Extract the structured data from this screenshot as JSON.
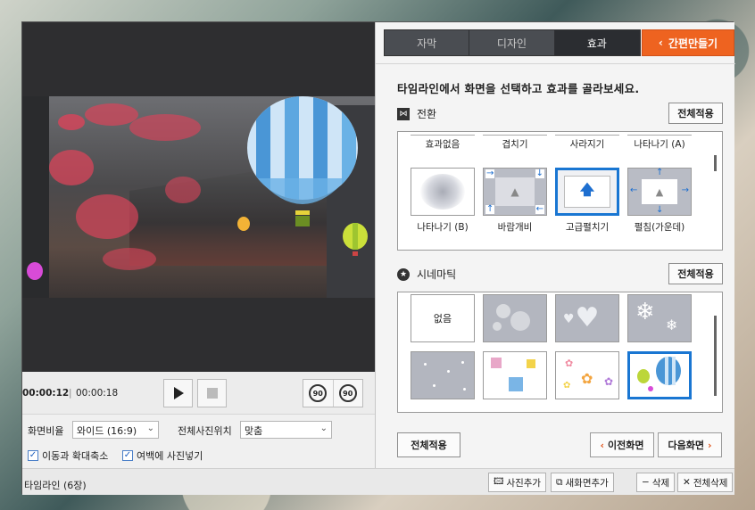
{
  "player": {
    "current_time": "00:00:12",
    "separator": "|",
    "total_time": "00:00:18",
    "rotate_left_label": "90",
    "rotate_right_label": "90"
  },
  "options": {
    "aspect_label": "화면비율",
    "aspect_value": "와이드 (16:9)",
    "photo_pos_label": "전체사진위치",
    "photo_pos_value": "맞춤",
    "move_zoom_label": "이동과 확대축소",
    "move_zoom_checked": true,
    "fill_margin_label": "여백에 사진넣기",
    "fill_margin_checked": true
  },
  "status": {
    "timeline_label": "타임라인 (6장)",
    "add_photo": "사진추가",
    "add_new_screen": "새화면추가",
    "delete": "삭제",
    "delete_all": "전체삭제"
  },
  "tabs": [
    {
      "label": "자막",
      "active": false
    },
    {
      "label": "디자인",
      "active": false
    },
    {
      "label": "효과",
      "active": true
    }
  ],
  "quick_make": "간편만들기",
  "instruction": "타임라인에서 화면을 선택하고 효과를 골라보세요.",
  "transition": {
    "title": "전환",
    "apply_all": "전체적용",
    "top_labels": [
      "효과없음",
      "겹치기",
      "사라지기",
      "나타나기 (A)"
    ],
    "items": [
      {
        "label": "나타나기 (B)",
        "icon": "radial-fade-icon",
        "selected": false
      },
      {
        "label": "바람개비",
        "icon": "pinwheel-icon",
        "selected": false
      },
      {
        "label": "고급펼치기",
        "icon": "page-unfold-icon",
        "selected": true
      },
      {
        "label": "펼침(가운데)",
        "icon": "expand-center-icon",
        "selected": false
      }
    ]
  },
  "cinematic": {
    "title": "시네마틱",
    "apply_all": "전체적용",
    "items": [
      {
        "label": "없음",
        "icon": "none",
        "selected": false
      },
      {
        "label": "",
        "icon": "bubbles-icon",
        "selected": false
      },
      {
        "label": "",
        "icon": "hearts-icon",
        "selected": false
      },
      {
        "label": "",
        "icon": "snowflake-icon",
        "selected": false
      },
      {
        "label": "",
        "icon": "dots-icon",
        "selected": false
      },
      {
        "label": "",
        "icon": "gifts-icon",
        "selected": false
      },
      {
        "label": "",
        "icon": "flowers-icon",
        "selected": false
      },
      {
        "label": "",
        "icon": "balloons-icon",
        "selected": true
      }
    ]
  },
  "footer": {
    "apply_all": "전체적용",
    "prev": "이전화면",
    "next": "다음화면"
  },
  "colors": {
    "accent_orange": "#ee6320",
    "selection_blue": "#1976d2",
    "tab_dark": "#2b2d31"
  }
}
